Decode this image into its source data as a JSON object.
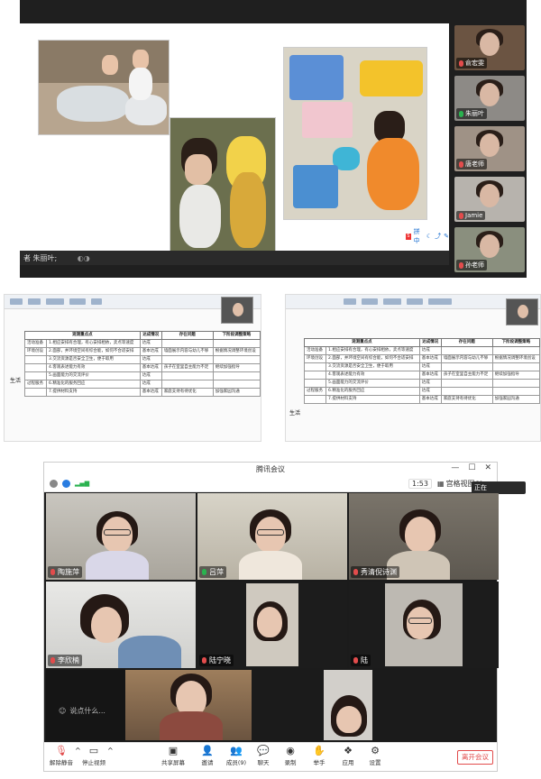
{
  "top_share": {
    "caption": "者 朱丽叶;",
    "toolbar_label": "拼中",
    "participants": [
      {
        "name": "俞宏雯",
        "mic": "off"
      },
      {
        "name": "朱丽叶",
        "mic": "on"
      },
      {
        "name": "唐老师",
        "mic": "off"
      },
      {
        "name": "Jamie",
        "mic": "off"
      },
      {
        "name": "孙老师",
        "mic": "off"
      }
    ]
  },
  "doc_left": {
    "headers": [
      "观测重点点",
      "达成情况",
      "存在问题",
      "下阶段调整策略"
    ],
    "rows": [
      {
        "cat": "活动准备",
        "item": "1.相应安排有合理，有心安排相依，卖点等速度",
        "status": "达成",
        "issue": "",
        "plan": ""
      },
      {
        "cat": "环境创设",
        "item": "2.面部，并环境空间有综合能，如何不合适安排",
        "status": "基本达成",
        "issue": "墙面展示内容与幼儿不够",
        "plan": "根据情况调整环境创设"
      },
      {
        "cat": "",
        "item": "3.交流资源是否安全卫生，便于取用",
        "status": "达成",
        "issue": "",
        "plan": ""
      },
      {
        "cat": "",
        "item": "4.客观表述能力有效",
        "status": "基本达成",
        "issue": "孩子在室里自主能力不足",
        "plan": "继续加强指导"
      },
      {
        "cat": "",
        "item": "5.画面能力的交流评价",
        "status": "达成",
        "issue": "",
        "plan": ""
      },
      {
        "cat": "过程服务",
        "item": "6.精准化的服务回应",
        "status": "达成",
        "issue": "",
        "plan": ""
      },
      {
        "cat": "",
        "item": "7.提供材料支持",
        "status": "基本达成",
        "issue": "家庭支持有待优化",
        "plan": "加强家园沟通"
      }
    ],
    "side_label": "生活"
  },
  "doc_right": {
    "headers": [
      "观测重点点",
      "达成情况",
      "存在问题",
      "下阶段调整策略"
    ],
    "rows": [
      {
        "cat": "活动准备",
        "item": "1.相应安排有合理，有心安排相依，卖点等速度",
        "status": "达成",
        "issue": "",
        "plan": ""
      },
      {
        "cat": "环境创设",
        "item": "2.面部，并环境空间有综合能，如何不合适安排",
        "status": "基本达成",
        "issue": "墙面展示内容与幼儿不够",
        "plan": "根据情况调整环境创设"
      },
      {
        "cat": "",
        "item": "3.交流资源是否安全卫生，便于取用",
        "status": "达成",
        "issue": "",
        "plan": ""
      },
      {
        "cat": "",
        "item": "4.客观表述能力有效",
        "status": "基本达成",
        "issue": "孩子在室里自主能力不足",
        "plan": "继续加强指导"
      },
      {
        "cat": "",
        "item": "5.画面能力的交流评价",
        "status": "达成",
        "issue": "",
        "plan": ""
      },
      {
        "cat": "过程服务",
        "item": "6.精准化的服务回应",
        "status": "达成",
        "issue": "",
        "plan": ""
      },
      {
        "cat": "",
        "item": "7.提供材料支持",
        "status": "基本达成",
        "issue": "家庭支持有待优化",
        "plan": "加强家园沟通"
      }
    ],
    "side_label": "生活"
  },
  "meeting": {
    "title": "腾讯会议",
    "timer": "1:53",
    "view_label": "宫格视图",
    "side_pill": "正在",
    "saying": "说点什么...",
    "tiles": [
      {
        "name": "陶施萍",
        "mic": "off"
      },
      {
        "name": "吕萍",
        "mic": "on"
      },
      {
        "name": "秀清倪诗渊",
        "mic": "off"
      },
      {
        "name": "李欣楠",
        "mic": "off"
      },
      {
        "name": "陆宁晓",
        "mic": "off"
      },
      {
        "name": "陆",
        "mic": "off"
      },
      {
        "name": "",
        "mic": ""
      },
      {
        "name": "",
        "mic": ""
      },
      {
        "name": "",
        "mic": ""
      }
    ],
    "bar": {
      "unmute": "解除静音",
      "stop_video": "停止视频",
      "share": "共享屏幕",
      "invite": "邀请",
      "members": "成员(9)",
      "chat": "聊天",
      "record": "录制",
      "raise_hand": "举手",
      "apps": "应用",
      "settings": "设置",
      "leave": "离开会议"
    }
  }
}
